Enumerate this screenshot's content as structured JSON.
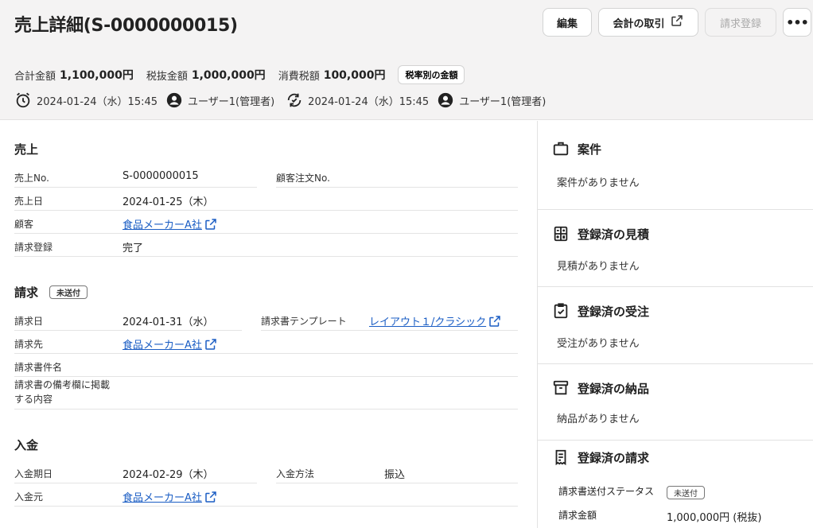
{
  "header": {
    "title": "売上詳細(S-0000000015)",
    "buttons": {
      "edit": "編集",
      "accounting": "会計の取引",
      "invoice": "請求登録",
      "more": "•••"
    },
    "totals": {
      "total_label": "合計金額",
      "total_value": "1,100,000円",
      "pretax_label": "税抜金額",
      "pretax_value": "1,000,000円",
      "tax_label": "消費税額",
      "tax_value": "100,000円",
      "by_rate_button": "税率別の金額"
    },
    "meta": {
      "created_at": "2024-01-24（水）15:45",
      "created_by": "ユーザー1(管理者)",
      "updated_at": "2024-01-24（水）15:45",
      "updated_by": "ユーザー1(管理者)"
    }
  },
  "sales": {
    "title": "売上",
    "no_label": "売上No.",
    "no_value": "S-0000000015",
    "order_no_label": "顧客注文No.",
    "date_label": "売上日",
    "date_value": "2024-01-25（木）",
    "customer_label": "顧客",
    "customer_value": "食品メーカーA社",
    "invoice_reg_label": "請求登録",
    "invoice_reg_value": "完了"
  },
  "billing": {
    "title": "請求",
    "status_badge": "未送付",
    "date_label": "請求日",
    "date_value": "2024-01-31（水）",
    "template_label": "請求書テンプレート",
    "template_value": "レイアウト１/クラシック",
    "to_label": "請求先",
    "to_value": "食品メーカーA社",
    "doc_name_label": "請求書件名",
    "remarks_label_1": "請求書の備考欄に掲載",
    "remarks_label_2": "する内容"
  },
  "payment": {
    "title": "入金",
    "due_label": "入金期日",
    "due_value": "2024-02-29（木）",
    "method_label": "入金方法",
    "method_value": "振込",
    "payer_label": "入金元",
    "payer_value": "食品メーカーA社"
  },
  "side": {
    "project_title": "案件",
    "project_empty": "案件がありません",
    "estimate_title": "登録済の見積",
    "estimate_empty": "見積がありません",
    "order_title": "登録済の受注",
    "order_empty": "受注がありません",
    "delivery_title": "登録済の納品",
    "delivery_empty": "納品がありません",
    "invoice_title": "登録済の請求",
    "invoice_status_label": "請求書送付ステータス",
    "invoice_status_value": "未送付",
    "invoice_amount_label": "請求金額",
    "invoice_amount_value": "1,000,000円 (税抜)"
  }
}
